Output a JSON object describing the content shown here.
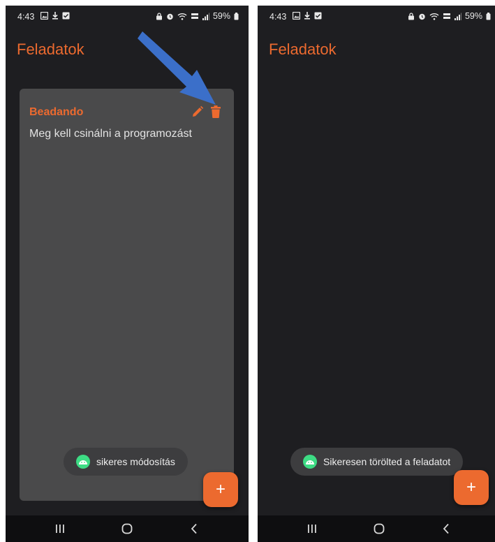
{
  "colors": {
    "accent": "#ec6a2f",
    "background": "#1e1e21",
    "card": "#4a4a4b",
    "toast_icon": "#3ddc84",
    "arrow": "#3b6fc9"
  },
  "screens": [
    {
      "status": {
        "time": "4:43",
        "battery": "59%"
      },
      "app_title": "Feladatok",
      "task": {
        "title": "Beadando",
        "description": "Meg kell csinálni a programozást"
      },
      "toast": "sikeres módosítás",
      "fab_label": "+"
    },
    {
      "status": {
        "time": "4:43",
        "battery": "59%"
      },
      "app_title": "Feladatok",
      "toast": "Sikeresen törölted a feladatot",
      "fab_label": "+"
    }
  ],
  "icons": {
    "status_left": [
      "gallery-icon",
      "download-icon",
      "check-icon"
    ],
    "status_right": [
      "lock-icon",
      "alarm-icon",
      "wifi-icon",
      "volte-icon",
      "signal-icon",
      "battery-icon"
    ],
    "task_actions": [
      "edit-icon",
      "delete-icon"
    ],
    "nav": [
      "recents-icon",
      "home-icon",
      "back-icon"
    ]
  }
}
